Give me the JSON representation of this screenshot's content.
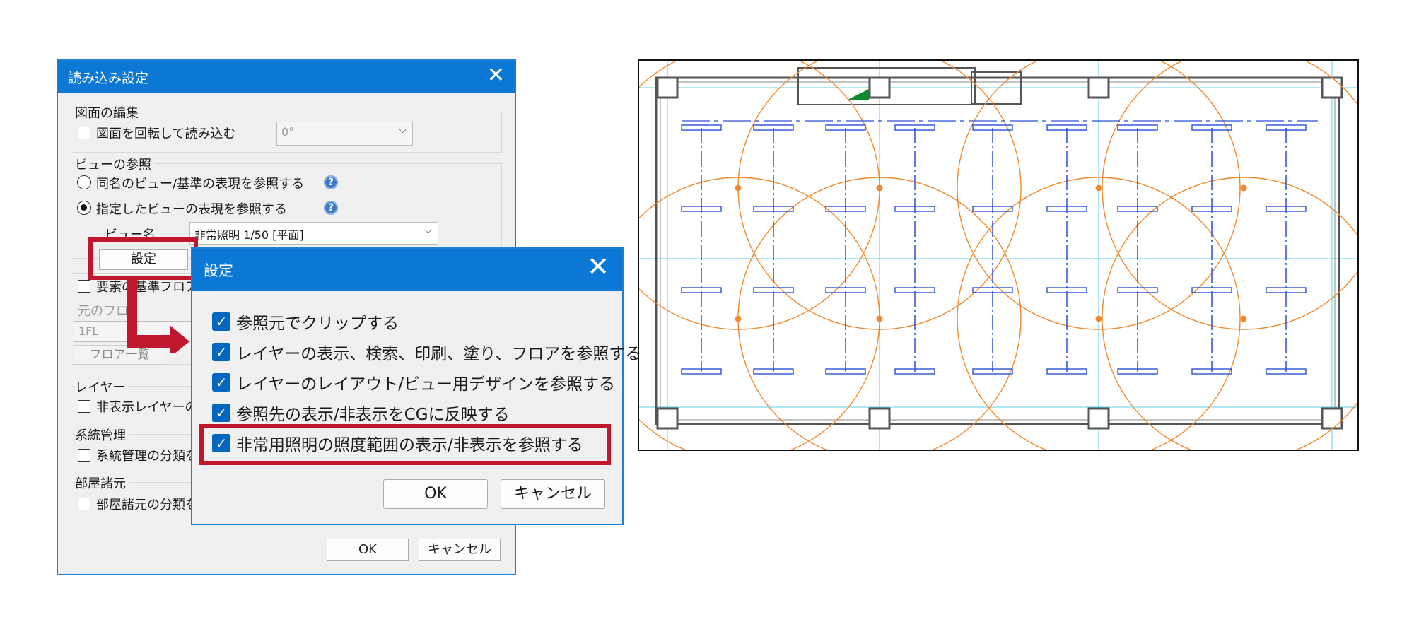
{
  "main_dialog": {
    "title": "読み込み設定",
    "close_glyph": "✕",
    "drawing_group": {
      "label": "図面の編集",
      "rotate_label": "図面を回転して読み込む",
      "rotate_checked": false,
      "angle_value": "0°"
    },
    "view_group": {
      "label": "ビューの参照",
      "option1": "同名のビュー/基準の表現を参照する",
      "option2": "指定したビューの表現を参照する",
      "selected_option": 2,
      "view_name_label": "ビュー名",
      "view_name_value": "非常照明 1/50 [平面]",
      "settings_button": "設定"
    },
    "floor_group": {
      "checkbox_label": "要素の基準フロア",
      "source_floor_label": "元のフロ",
      "floor_value": "1FL",
      "floor_list_button": "フロア一覧"
    },
    "layer_group": {
      "label": "レイヤー",
      "checkbox_label": "非表示レイヤーの"
    },
    "system_group": {
      "label": "系統管理",
      "checkbox_label": "系統管理の分類を"
    },
    "room_group": {
      "label": "部屋諸元",
      "checkbox_label": "部屋諸元の分類を"
    },
    "ok_button": "OK",
    "cancel_button": "キャンセル"
  },
  "settings_dialog": {
    "title": "設定",
    "close_glyph": "✕",
    "options": [
      {
        "label": "参照元でクリップする",
        "checked": true
      },
      {
        "label": "レイヤーの表示、検索、印刷、塗り、フロアを参照する",
        "checked": true
      },
      {
        "label": "レイヤーのレイアウト/ビュー用デザインを参照する",
        "checked": true
      },
      {
        "label": "参照先の表示/非表示をCGに反映する",
        "checked": true
      },
      {
        "label": "非常用照明の照度範囲の表示/非表示を参照する",
        "checked": true
      }
    ],
    "ok_button": "OK",
    "cancel_button": "キャンセル"
  },
  "colors": {
    "accent": "#0a78d4",
    "highlight_red": "#c0162e",
    "plan_blue": "#2a4fd6",
    "plan_cyan": "#5fd2e8",
    "plan_orange": "#f08a2c"
  }
}
